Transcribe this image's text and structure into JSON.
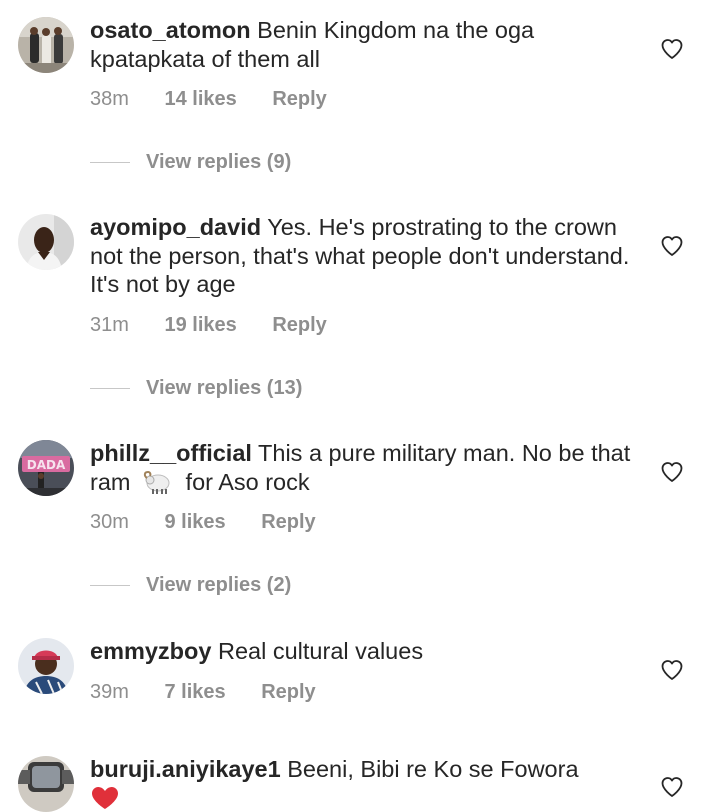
{
  "comments": [
    {
      "username": "osato_atomon",
      "text": "Benin Kingdom na the oga kpatapkata of them all",
      "time": "38m",
      "likes": "14 likes",
      "reply": "Reply",
      "view_replies": "View replies (9)",
      "avatar_icon": "avatar-group-photo"
    },
    {
      "username": "ayomipo_david",
      "text": "Yes. He's prostrating to the crown not the person, that's what people don't understand. It's not by age",
      "time": "31m",
      "likes": "19 likes",
      "reply": "Reply",
      "view_replies": "View replies (13)",
      "avatar_icon": "avatar-portrait"
    },
    {
      "username": "phillz__official",
      "text_before": "This a pure military man. No be that ram",
      "emoji": "ram-emoji",
      "text_after": "for Aso rock",
      "time": "30m",
      "likes": "9 likes",
      "reply": "Reply",
      "view_replies": "View replies (2)",
      "avatar_icon": "avatar-dada-sign"
    },
    {
      "username": "emmyzboy",
      "text": "Real cultural values",
      "time": "39m",
      "likes": "7 likes",
      "reply": "Reply",
      "avatar_icon": "avatar-man-cap"
    },
    {
      "username": "buruji.aniyikaye1",
      "text": "Beeni, Bibi re Ko se Fowora",
      "emoji": "red-heart-emoji",
      "avatar_icon": "avatar-watch"
    }
  ],
  "colors": {
    "text": "#262626",
    "meta": "#8e8e8e",
    "divider": "#c7c7c7",
    "heart_outline": "#262626"
  },
  "icons": {
    "like": "heart-outline-icon"
  }
}
